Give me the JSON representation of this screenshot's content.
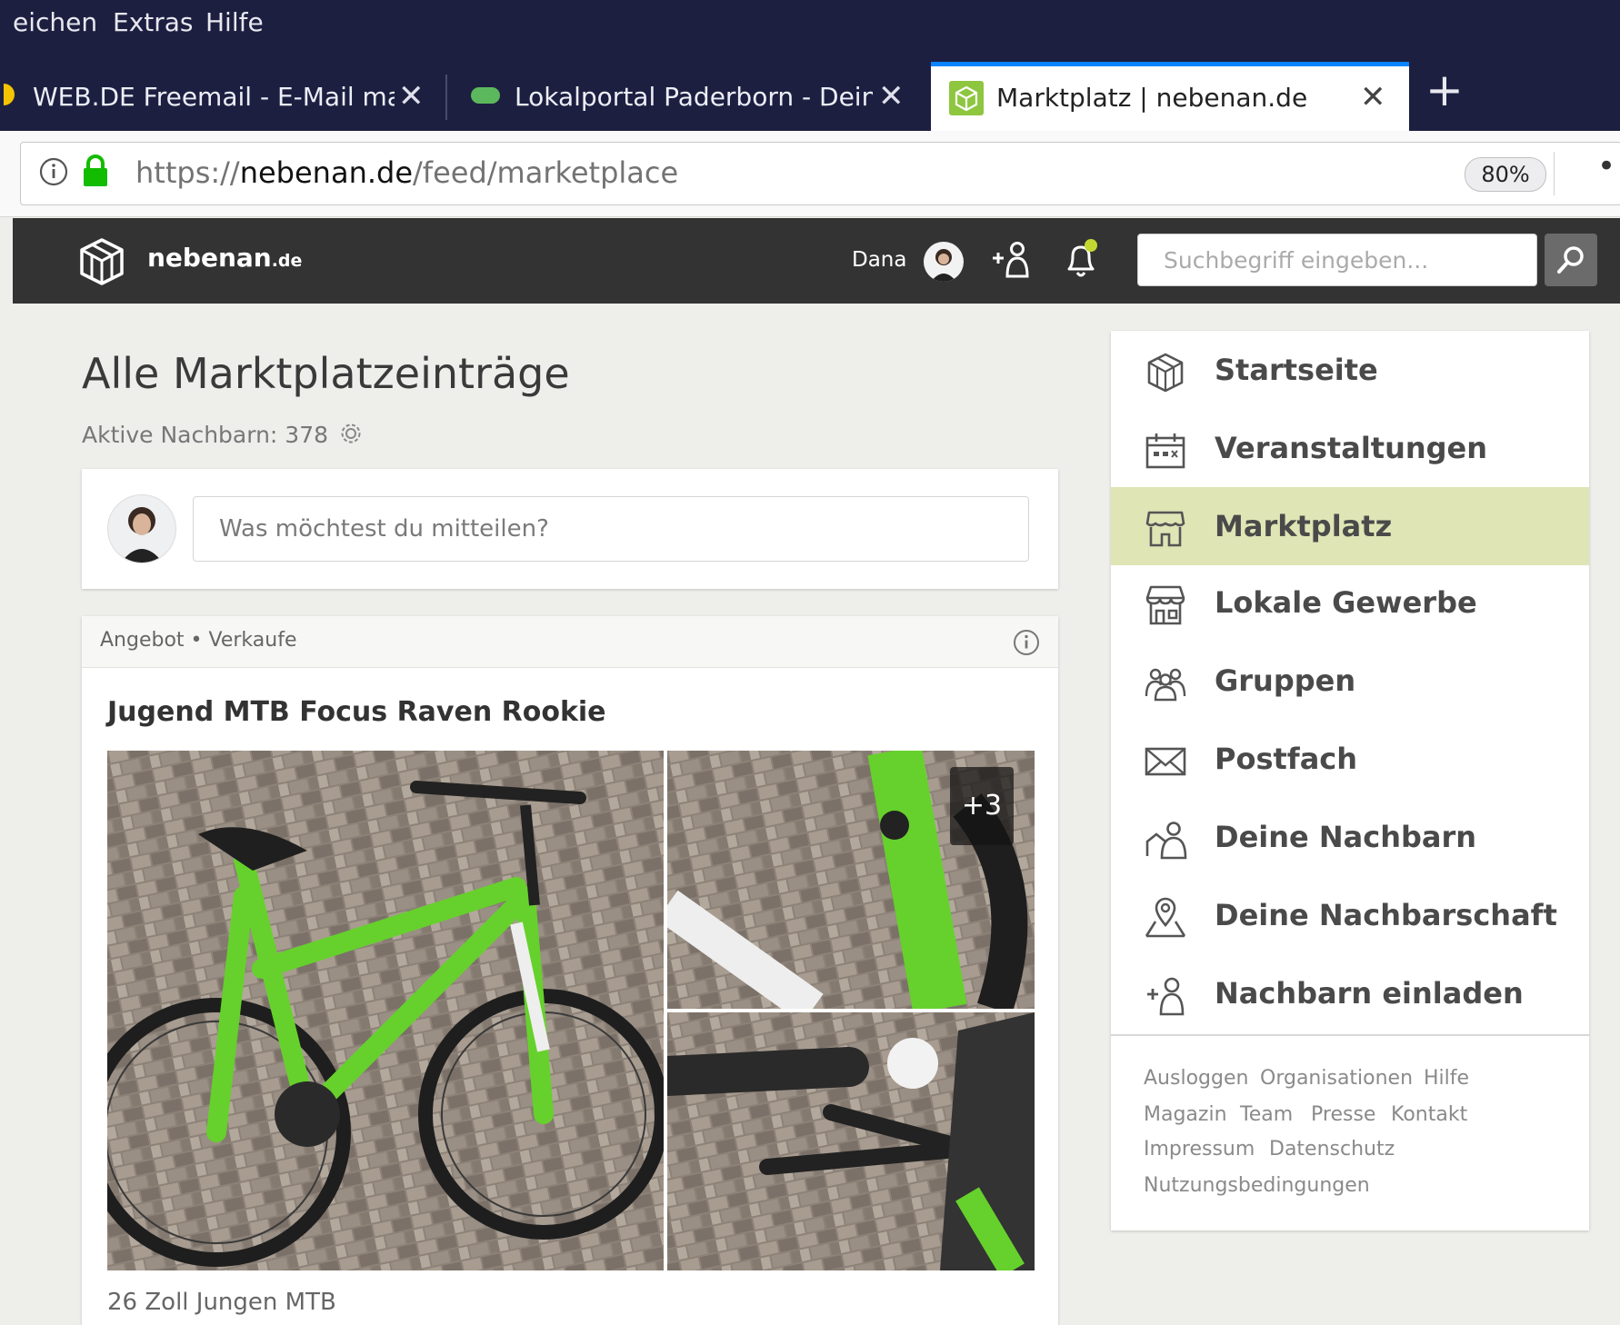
{
  "menubar": {
    "items": [
      "eichen",
      "Extras",
      "Hilfe"
    ]
  },
  "tabs": [
    {
      "label": "WEB.DE Freemail - E-Mail made in Germany",
      "active": false
    },
    {
      "label": "Lokalportal Paderborn - Deine Stadt",
      "active": false
    },
    {
      "label": "Marktplatz | nebenan.de",
      "active": true
    }
  ],
  "navbar": {
    "url_scheme": "https://",
    "url_domain": "nebenan.de",
    "url_path": "/feed/marketplace",
    "zoom": "80%",
    "menu": "•••"
  },
  "header": {
    "logo_main": "nebenan",
    "logo_sub": ".de",
    "user_name": "Dana",
    "search_placeholder": "Suchbegriff eingeben..."
  },
  "main": {
    "title": "Alle Marktplatzeinträge",
    "active_neighbors": "Aktive Nachbarn: 378",
    "post_placeholder": "Was möchtest du mitteilen?",
    "listing": {
      "category": "Angebot • Verkaufe",
      "title": "Jugend MTB Focus Raven Rookie",
      "more_images": "+3",
      "description": "26 Zoll Jungen MTB"
    }
  },
  "sidebar": {
    "items": [
      {
        "label": "Startseite",
        "icon": "house-icon"
      },
      {
        "label": "Veranstaltungen",
        "icon": "calendar-icon"
      },
      {
        "label": "Marktplatz",
        "icon": "market-icon",
        "active": true
      },
      {
        "label": "Lokale Gewerbe",
        "icon": "shop-icon"
      },
      {
        "label": "Gruppen",
        "icon": "group-icon"
      },
      {
        "label": "Postfach",
        "icon": "envelope-icon"
      },
      {
        "label": "Deine Nachbarn",
        "icon": "neighbors-icon"
      },
      {
        "label": "Deine Nachbarschaft",
        "icon": "location-icon"
      },
      {
        "label": "Nachbarn einladen",
        "icon": "invite-icon"
      }
    ],
    "footer_links": [
      "Ausloggen",
      "Organisationen",
      "Hilfe",
      "Magazin",
      "Team",
      "Presse",
      "Kontakt",
      "Impressum",
      "Datenschutz",
      "Nutzungsbedingungen"
    ]
  },
  "colors": {
    "browser_dark": "#1d1f41",
    "tab_accent": "#0a84ff",
    "site_header": "#333333",
    "page_bg": "#eeeeeb",
    "active_nav": "#dfe5b5",
    "brand_green": "#8ec63f"
  }
}
